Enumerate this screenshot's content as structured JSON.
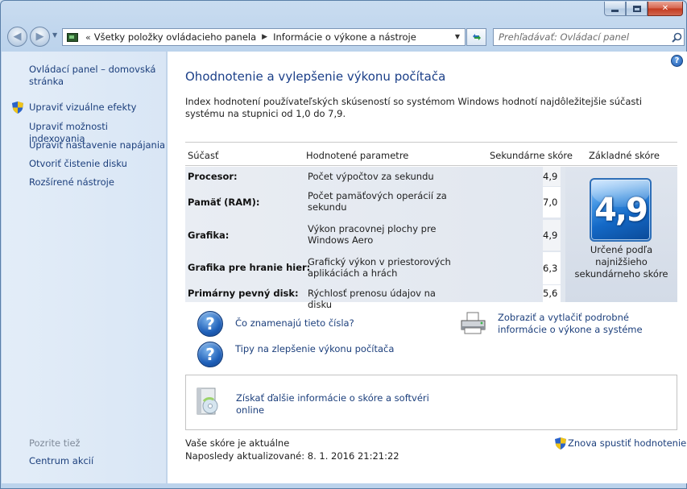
{
  "window": {
    "caption": {
      "minimize": "",
      "maximize": "",
      "close": "✕"
    }
  },
  "nav": {
    "back_glyph": "◀",
    "forward_glyph": "▶",
    "address_separator": "«",
    "crumbs": [
      "Všetky položky ovládacieho panela",
      "Informácie o výkone a nástroje"
    ],
    "search_placeholder": "Prehľadávať: Ovládací panel"
  },
  "sidebar": {
    "home": "Ovládací panel – domovská stránka",
    "links": [
      "Upraviť vizuálne efekty",
      "Upraviť možnosti indexovania",
      "Upraviť nastavenie napájania",
      "Otvoriť čistenie disku",
      "Rozšírené nástroje"
    ],
    "see_also_title": "Pozrite tiež",
    "see_also_links": [
      "Centrum akcií"
    ]
  },
  "main": {
    "title": "Ohodnotenie a vylepšenie výkonu počítača",
    "intro": "Index hodnotení používateľských skúseností so systémom Windows hodnotí najdôležitejšie súčasti systému na stupnici od 1,0 do 7,9.",
    "table": {
      "headers": [
        "Súčasť",
        "Hodnotené parametre",
        "Sekundárne skóre",
        "Základné skóre"
      ],
      "rows": [
        {
          "component": "Procesor:",
          "parameter": "Počet výpočtov za sekundu",
          "score": "4,9"
        },
        {
          "component": "Pamäť (RAM):",
          "parameter": "Počet pamäťových operácií za sekundu",
          "score": "7,0"
        },
        {
          "component": "Grafika:",
          "parameter": "Výkon pracovnej plochy pre Windows Aero",
          "score": "4,9"
        },
        {
          "component": "Grafika pre hranie hier:",
          "parameter": "Grafický výkon v priestorových aplikáciách a hrách",
          "score": "6,3"
        },
        {
          "component": "Primárny pevný disk:",
          "parameter": "Rýchlosť prenosu údajov na disku",
          "score": "5,6"
        }
      ],
      "base_score": "4,9",
      "base_caption": "Určené podľa najnižšieho sekundárneho skóre"
    },
    "links": {
      "what_numbers_mean": "Čo znamenajú tieto čísla?",
      "tips": "Tipy na zlepšenie výkonu počítača",
      "print_details": "Zobraziť a vytlačiť podrobné informácie o výkone a systéme",
      "more_info": "Získať ďalšie informácie o skóre a softvéri online",
      "rerun": "Znova spustiť hodnotenie"
    },
    "status": {
      "current": "Vaše skóre je aktuálne",
      "last_updated": "Naposledy aktualizované: 8. 1. 2016 21:21:22"
    },
    "help_glyph": "?"
  }
}
